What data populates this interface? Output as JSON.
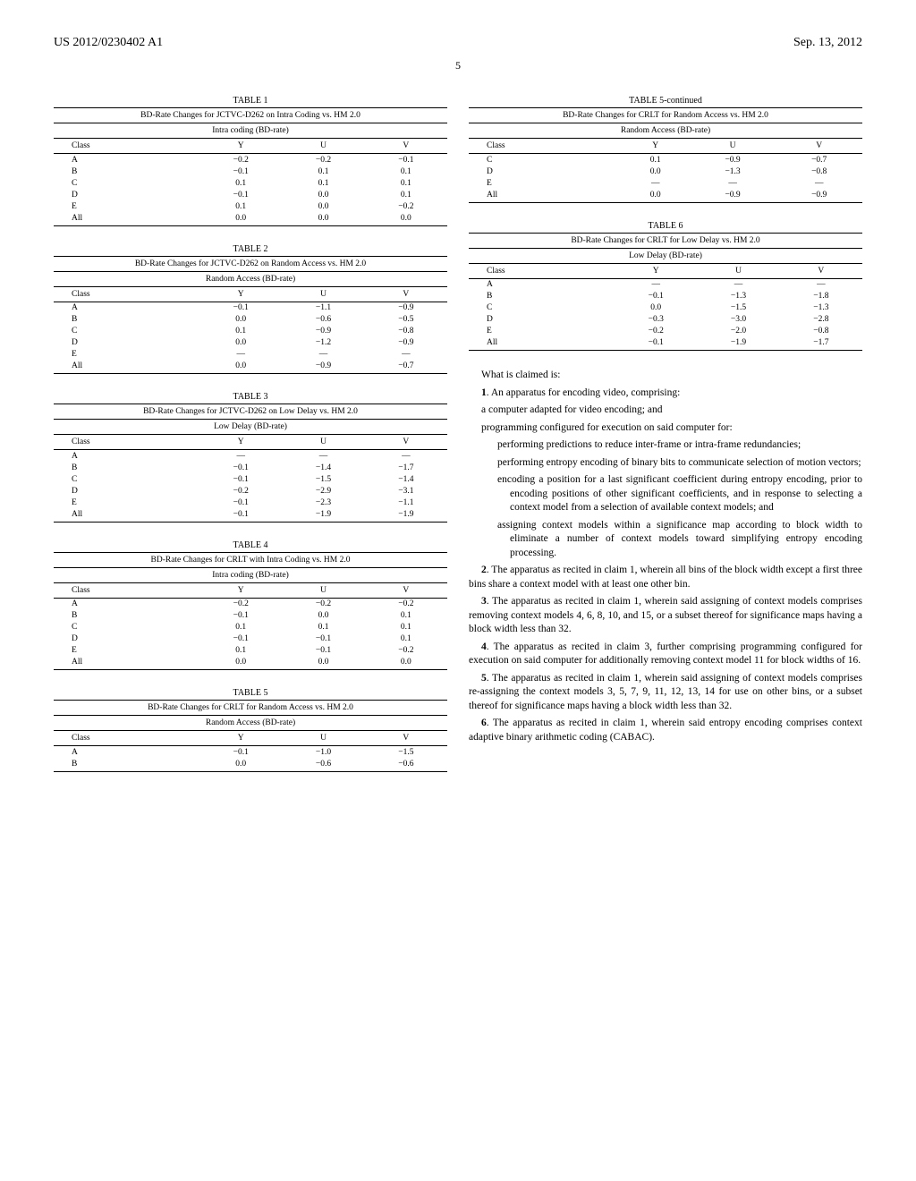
{
  "header": {
    "left": "US 2012/0230402 A1",
    "right": "Sep. 13, 2012"
  },
  "page_number": "5",
  "columns_common": {
    "class_header": "Class",
    "y": "Y",
    "u": "U",
    "v": "V"
  },
  "left_tables": [
    {
      "label": "TABLE 1",
      "title": "BD-Rate Changes for JCTVC-D262 on Intra Coding vs. HM 2.0",
      "sub": "Intra coding (BD-rate)",
      "rows": [
        [
          "A",
          "−0.2",
          "−0.2",
          "−0.1"
        ],
        [
          "B",
          "−0.1",
          "0.1",
          "0.1"
        ],
        [
          "C",
          "0.1",
          "0.1",
          "0.1"
        ],
        [
          "D",
          "−0.1",
          "0.0",
          "0.1"
        ],
        [
          "E",
          "0.1",
          "0.0",
          "−0.2"
        ],
        [
          "All",
          "0.0",
          "0.0",
          "0.0"
        ]
      ]
    },
    {
      "label": "TABLE 2",
      "title": "BD-Rate Changes for JCTVC-D262 on Random Access vs. HM 2.0",
      "sub": "Random Access (BD-rate)",
      "rows": [
        [
          "A",
          "−0.1",
          "−1.1",
          "−0.9"
        ],
        [
          "B",
          "0.0",
          "−0.6",
          "−0.5"
        ],
        [
          "C",
          "0.1",
          "−0.9",
          "−0.8"
        ],
        [
          "D",
          "0.0",
          "−1.2",
          "−0.9"
        ],
        [
          "E",
          "—",
          "—",
          "—"
        ],
        [
          "All",
          "0.0",
          "−0.9",
          "−0.7"
        ]
      ]
    },
    {
      "label": "TABLE 3",
      "title": "BD-Rate Changes for JCTVC-D262 on Low Delay vs. HM 2.0",
      "sub": "Low Delay (BD-rate)",
      "rows": [
        [
          "A",
          "—",
          "—",
          "—"
        ],
        [
          "B",
          "−0.1",
          "−1.4",
          "−1.7"
        ],
        [
          "C",
          "−0.1",
          "−1.5",
          "−1.4"
        ],
        [
          "D",
          "−0.2",
          "−2.9",
          "−3.1"
        ],
        [
          "E",
          "−0.1",
          "−2.3",
          "−1.1"
        ],
        [
          "All",
          "−0.1",
          "−1.9",
          "−1.9"
        ]
      ]
    },
    {
      "label": "TABLE 4",
      "title": "BD-Rate Changes for CRLT with Intra Coding vs. HM 2.0",
      "sub": "Intra coding (BD-rate)",
      "rows": [
        [
          "A",
          "−0.2",
          "−0.2",
          "−0.2"
        ],
        [
          "B",
          "−0.1",
          "0.0",
          "0.1"
        ],
        [
          "C",
          "0.1",
          "0.1",
          "0.1"
        ],
        [
          "D",
          "−0.1",
          "−0.1",
          "0.1"
        ],
        [
          "E",
          "0.1",
          "−0.1",
          "−0.2"
        ],
        [
          "All",
          "0.0",
          "0.0",
          "0.0"
        ]
      ]
    },
    {
      "label": "TABLE 5",
      "title": "BD-Rate Changes for CRLT for Random Access vs. HM 2.0",
      "sub": "Random Access (BD-rate)",
      "rows": [
        [
          "A",
          "−0.1",
          "−1.0",
          "−1.5"
        ],
        [
          "B",
          "0.0",
          "−0.6",
          "−0.6"
        ]
      ]
    }
  ],
  "right_tables": [
    {
      "label": "TABLE 5-continued",
      "title": "BD-Rate Changes for CRLT for Random Access vs. HM 2.0",
      "sub": "Random Access (BD-rate)",
      "rows": [
        [
          "C",
          "0.1",
          "−0.9",
          "−0.7"
        ],
        [
          "D",
          "0.0",
          "−1.3",
          "−0.8"
        ],
        [
          "E",
          "—",
          "—",
          "—"
        ],
        [
          "All",
          "0.0",
          "−0.9",
          "−0.9"
        ]
      ]
    },
    {
      "label": "TABLE 6",
      "title": "BD-Rate Changes for CRLT for Low Delay vs. HM 2.0",
      "sub": "Low Delay (BD-rate)",
      "rows": [
        [
          "A",
          "—",
          "—",
          "—"
        ],
        [
          "B",
          "−0.1",
          "−1.3",
          "−1.8"
        ],
        [
          "C",
          "0.0",
          "−1.5",
          "−1.3"
        ],
        [
          "D",
          "−0.3",
          "−3.0",
          "−2.8"
        ],
        [
          "E",
          "−0.2",
          "−2.0",
          "−0.8"
        ],
        [
          "All",
          "−0.1",
          "−1.9",
          "−1.7"
        ]
      ]
    }
  ],
  "claims": {
    "intro": "What is claimed is:",
    "items": [
      {
        "num": "1",
        "type": "main",
        "lines": [
          "An apparatus for encoding video, comprising:",
          "a computer adapted for video encoding; and",
          "programming configured for execution on said computer for:",
          "performing predictions to reduce inter-frame or intra-frame redundancies;",
          "performing entropy encoding of binary bits to communicate selection of motion vectors;",
          "encoding a position for a last significant coefficient during entropy encoding, prior to encoding positions of other significant coefficients, and in response to selecting a context model from a selection of available context models; and",
          "assigning context models within a significance map according to block width to eliminate a number of context models toward simplifying entropy encoding processing."
        ]
      },
      {
        "num": "2",
        "type": "dep",
        "text": "The apparatus as recited in claim 1, wherein all bins of the block width except a first three bins share a context model with at least one other bin."
      },
      {
        "num": "3",
        "type": "dep",
        "text": "The apparatus as recited in claim 1, wherein said assigning of context models comprises removing context models 4, 6, 8, 10, and 15, or a subset thereof for significance maps having a block width less than 32."
      },
      {
        "num": "4",
        "type": "dep",
        "text": "The apparatus as recited in claim 3, further comprising programming configured for execution on said computer for additionally removing context model 11 for block widths of 16."
      },
      {
        "num": "5",
        "type": "dep",
        "text": "The apparatus as recited in claim 1, wherein said assigning of context models comprises re-assigning the context models 3, 5, 7, 9, 11, 12, 13, 14 for use on other bins, or a subset thereof for significance maps having a block width less than 32."
      },
      {
        "num": "6",
        "type": "dep",
        "text": "The apparatus as recited in claim 1, wherein said entropy encoding comprises context adaptive binary arithmetic coding (CABAC)."
      }
    ]
  }
}
